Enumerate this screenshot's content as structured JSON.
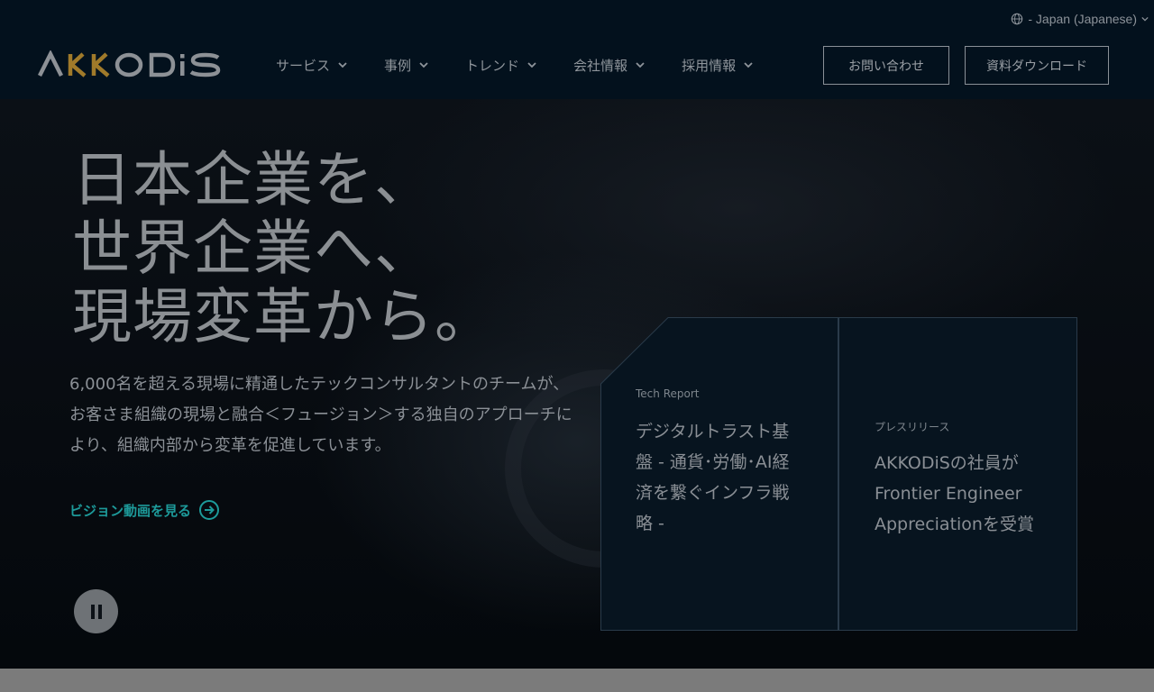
{
  "header": {
    "language": "- Japan (Japanese)",
    "logo_text": "AKKODiS",
    "nav": [
      {
        "label": "サービス"
      },
      {
        "label": "事例"
      },
      {
        "label": "トレンド"
      },
      {
        "label": "会社情報"
      },
      {
        "label": "採用情報"
      }
    ],
    "contact_label": "お問い合わせ",
    "download_label": "資料ダウンロード"
  },
  "hero": {
    "headline": [
      "日本企業を、",
      "世界企業へ、",
      "現場変革から。"
    ],
    "description": "6,000名を超える現場に精通したテックコンサルタントのチームが、お客さま組織の現場と融合＜フュージョン＞する独自のアプローチにより、組織内部から変革を促進しています。",
    "vision_link": "ビジョン動画を見る"
  },
  "cards": [
    {
      "tag": "Tech Report",
      "title": "デジタルトラスト基盤 - 通貨･労働･AI経済を繋ぐインフラ戦略 -"
    },
    {
      "tag": "プレスリリース",
      "title": "AKKODiSの社員がFrontier Engineer Appreciationを受賞"
    }
  ],
  "colors": {
    "header_bg": "#03111d",
    "accent_teal": "#1d9a9a",
    "logo_gold": "#a07a2a",
    "card_bg": "#07141f"
  }
}
